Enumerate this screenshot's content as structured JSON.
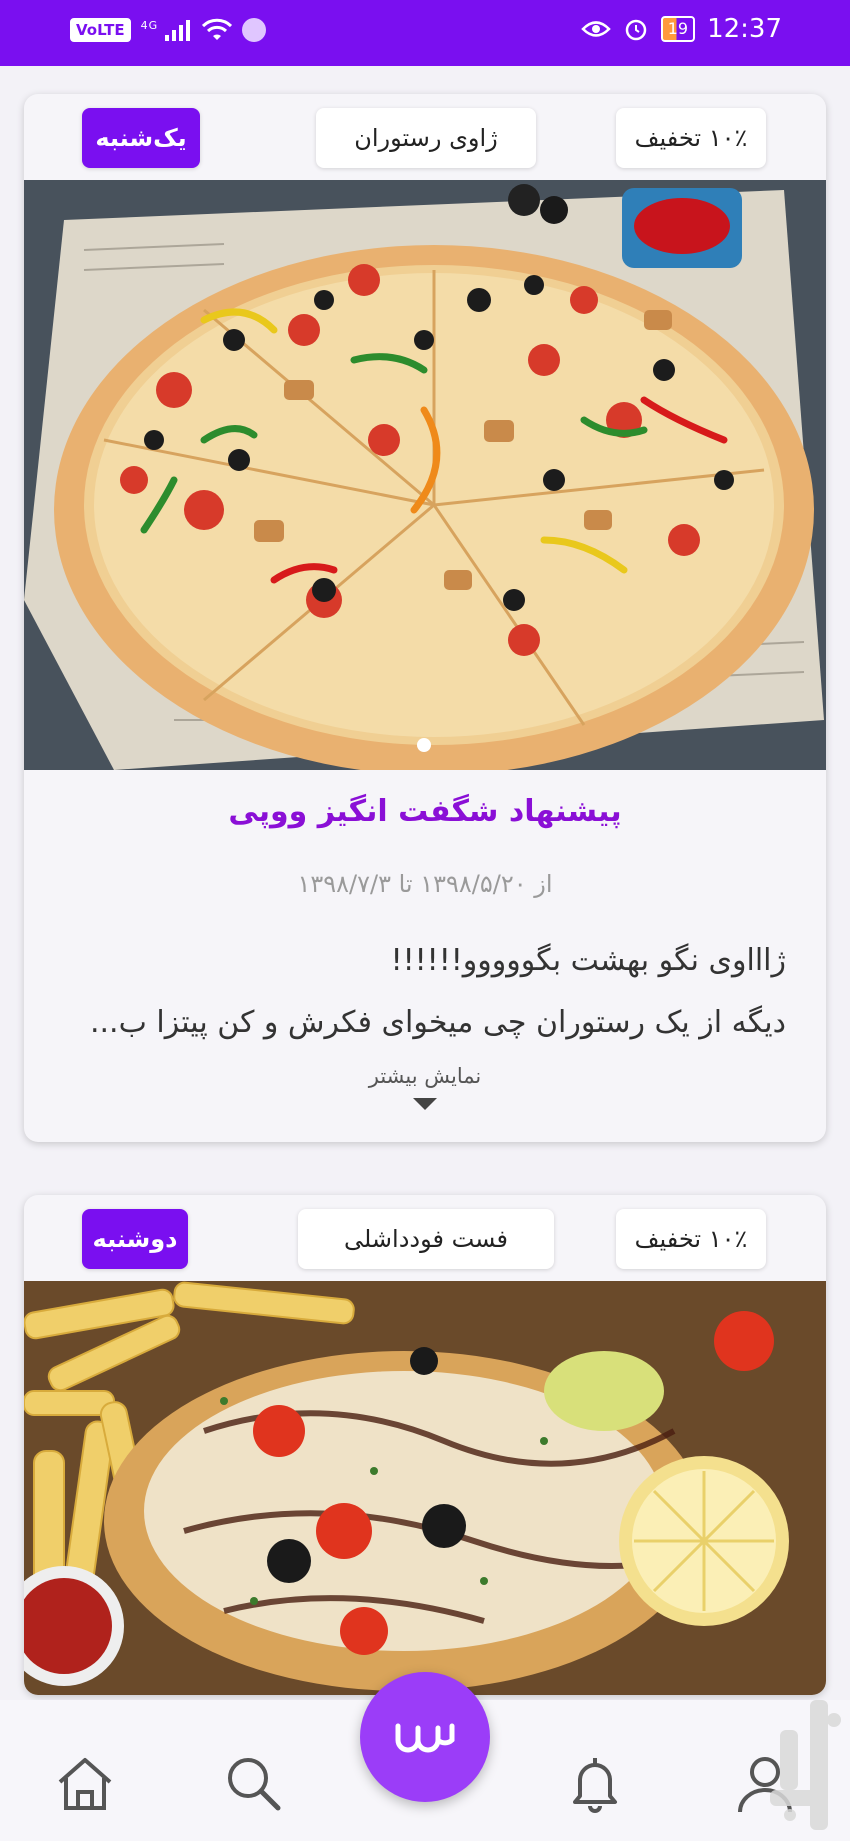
{
  "status_bar": {
    "volte": "VoLTE",
    "network": "4G",
    "battery": "19",
    "time": "12:37"
  },
  "cards": [
    {
      "discount": "۱۰٪ تخفیف",
      "restaurant": "ژاوی رستوران",
      "day": "یک‌شنبه",
      "title": "پیشنهاد شگفت انگیز ووپی",
      "date_range": "از ۱۳۹۸/۵/۲۰ تا ۱۳۹۸/۷/۳",
      "description_line1": "ژاااوی نگو بهشت بگووووو!!!!!!",
      "description_line2": "دیگه از یک رستوران چی میخوای فکرش و کن پیتزا ب...",
      "show_more": "نمایش بیشتر"
    },
    {
      "discount": "۱۰٪ تخفیف",
      "restaurant": "فست فودداشلی",
      "day": "دوشنبه"
    }
  ],
  "bottom_nav": {
    "items": [
      "home-icon",
      "search-icon",
      "fab-logo-icon",
      "bell-icon",
      "profile-icon"
    ]
  },
  "colors": {
    "brand": "#7a0ff0",
    "fab": "#9b3df8",
    "title": "#8a0fd6"
  }
}
